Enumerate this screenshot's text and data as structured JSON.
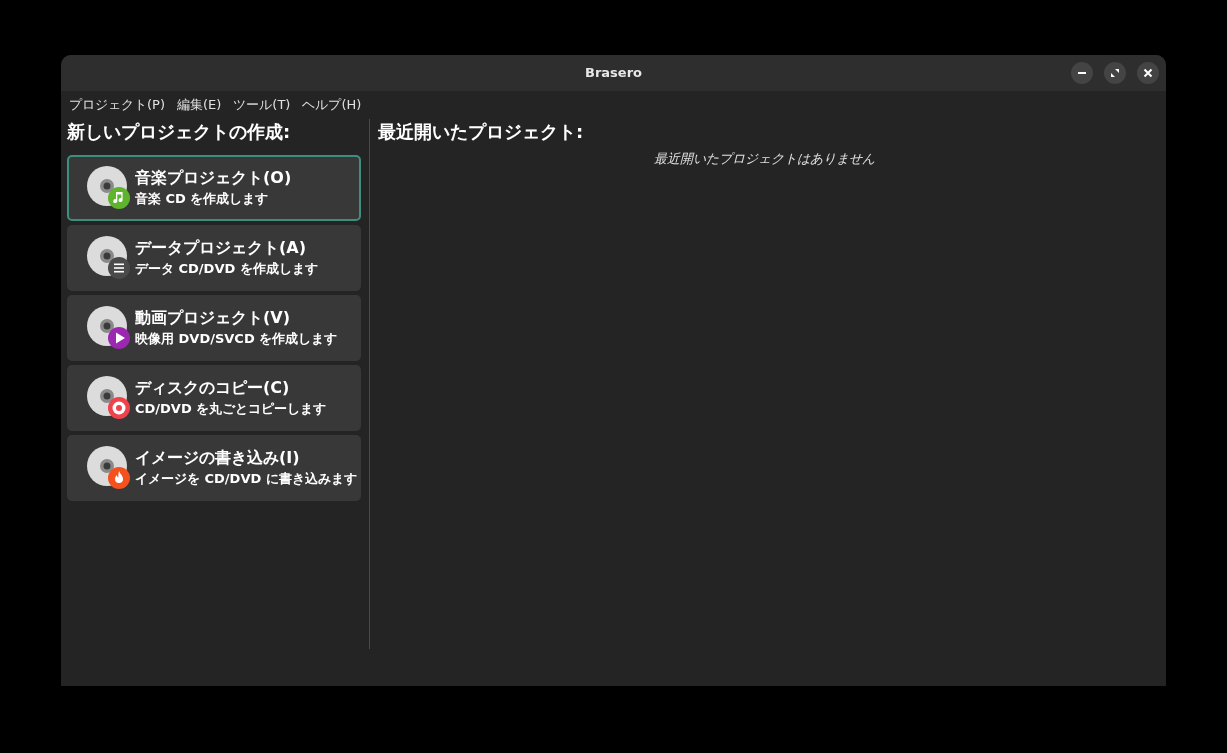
{
  "window": {
    "title": "Brasero"
  },
  "menu": [
    {
      "label": "プロジェクト(P)"
    },
    {
      "label": "編集(E)"
    },
    {
      "label": "ツール(T)"
    },
    {
      "label": "ヘルプ(H)"
    }
  ],
  "new_project": {
    "heading": "新しいプロジェクトの作成:",
    "items": [
      {
        "title": "音楽プロジェクト(O)",
        "subtitle": "音楽 CD を作成します",
        "kind": "music",
        "color": "#5fb32d",
        "selected": true
      },
      {
        "title": "データプロジェクト(A)",
        "subtitle": "データ CD/DVD を作成します",
        "kind": "data",
        "color": "#4a4a4a",
        "selected": false
      },
      {
        "title": "動画プロジェクト(V)",
        "subtitle": "映像用 DVD/SVCD を作成します",
        "kind": "video",
        "color": "#9c27b0",
        "selected": false
      },
      {
        "title": "ディスクのコピー(C)",
        "subtitle": "CD/DVD を丸ごとコピーします",
        "kind": "copy",
        "color": "#f0424a",
        "selected": false
      },
      {
        "title": "イメージの書き込み(I)",
        "subtitle": "イメージを CD/DVD に書き込みます",
        "kind": "burn",
        "color": "#f4511e",
        "selected": false
      }
    ]
  },
  "recent": {
    "heading": "最近開いたプロジェクト:",
    "empty_text": "最近開いたプロジェクトはありません"
  }
}
